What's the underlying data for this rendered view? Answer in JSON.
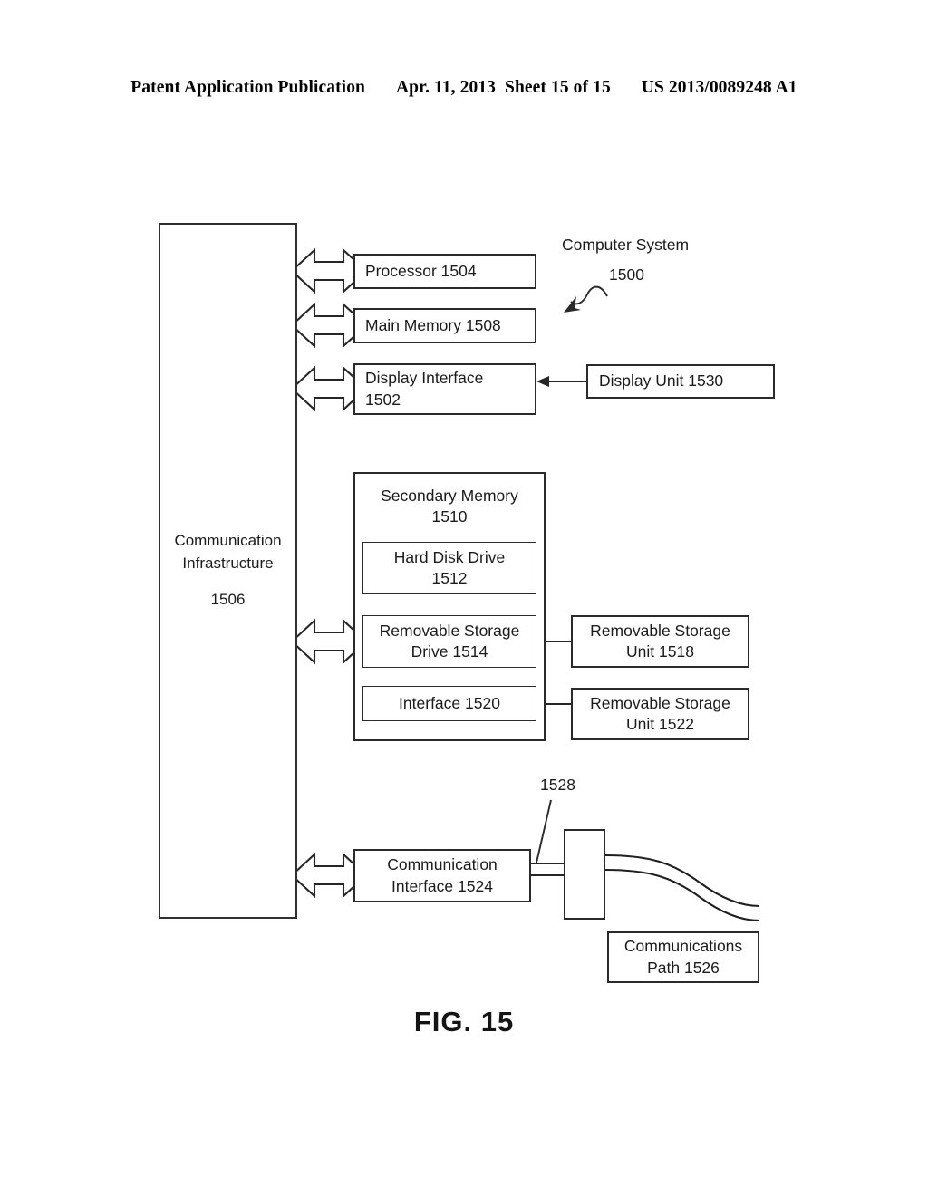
{
  "header": {
    "publication": "Patent Application Publication",
    "date": "Apr. 11, 2013",
    "sheet": "Sheet 15 of 15",
    "patent_number": "US 2013/0089248 A1"
  },
  "figure": {
    "caption": "FIG. 15",
    "system_label": "Computer System",
    "system_number": "1500",
    "lead_number_1528": "1528",
    "bus": {
      "line1": "Communication",
      "line2": "Infrastructure",
      "number": "1506"
    },
    "blocks": {
      "processor": "Processor 1504",
      "main_memory": "Main Memory 1508",
      "display_interface_line1": "Display Interface",
      "display_interface_line2": "1502",
      "display_unit": "Display Unit 1530",
      "secondary_memory_line1": "Secondary Memory",
      "secondary_memory_line2": "1510",
      "hard_disk_drive_line1": "Hard Disk Drive",
      "hard_disk_drive_line2": "1512",
      "removable_storage_drive_line1": "Removable Storage",
      "removable_storage_drive_line2": "Drive 1514",
      "interface": "Interface 1520",
      "removable_storage_unit_1518_line1": "Removable Storage",
      "removable_storage_unit_1518_line2": "Unit 1518",
      "removable_storage_unit_1522_line1": "Removable Storage",
      "removable_storage_unit_1522_line2": "Unit 1522",
      "communication_interface_line1": "Communication",
      "communication_interface_line2": "Interface 1524",
      "communications_path_line1": "Communications",
      "communications_path_line2": "Path 1526"
    }
  },
  "colors": {
    "ink": "#1b1b1b",
    "line": "#262626",
    "paper": "#ffffff"
  }
}
